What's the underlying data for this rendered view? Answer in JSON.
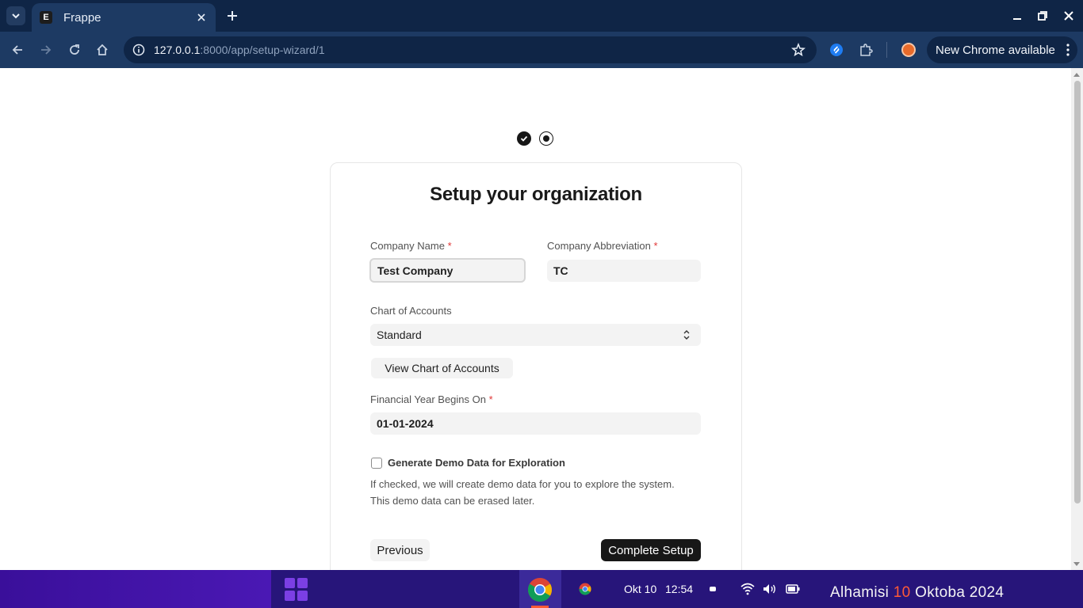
{
  "browser": {
    "tab_title": "Frappe",
    "tab_favicon": "E",
    "url_host": "127.0.0.1",
    "url_path": ":8000/app/setup-wizard/1",
    "update_label": "New Chrome available"
  },
  "wizard": {
    "title": "Setup your organization",
    "company_name_label": "Company Name",
    "company_name_value": "Test Company",
    "company_abbr_label": "Company Abbreviation",
    "company_abbr_value": "TC",
    "required_marker": "*",
    "chart_label": "Chart of Accounts",
    "chart_value": "Standard",
    "view_chart_label": "View Chart of Accounts",
    "fy_label": "Financial Year Begins On",
    "fy_value": "01-01-2024",
    "demo_label": "Generate Demo Data for Exploration",
    "demo_checked": false,
    "demo_help_line1": "If checked, we will create demo data for you to explore the system.",
    "demo_help_line2": "This demo data can be erased later.",
    "previous_label": "Previous",
    "complete_label": "Complete Setup"
  },
  "taskbar": {
    "clock_date": "Okt 10",
    "clock_time": "12:54",
    "date_day": "Alhamisi",
    "date_num": "10",
    "date_month_year": "Oktoba 2024"
  },
  "colors": {
    "chrome_frame": "#0f2546",
    "chrome_toolbar": "#1d3a63",
    "primary_button": "#171717",
    "required": "#e03636",
    "taskbar": "#27157a"
  }
}
